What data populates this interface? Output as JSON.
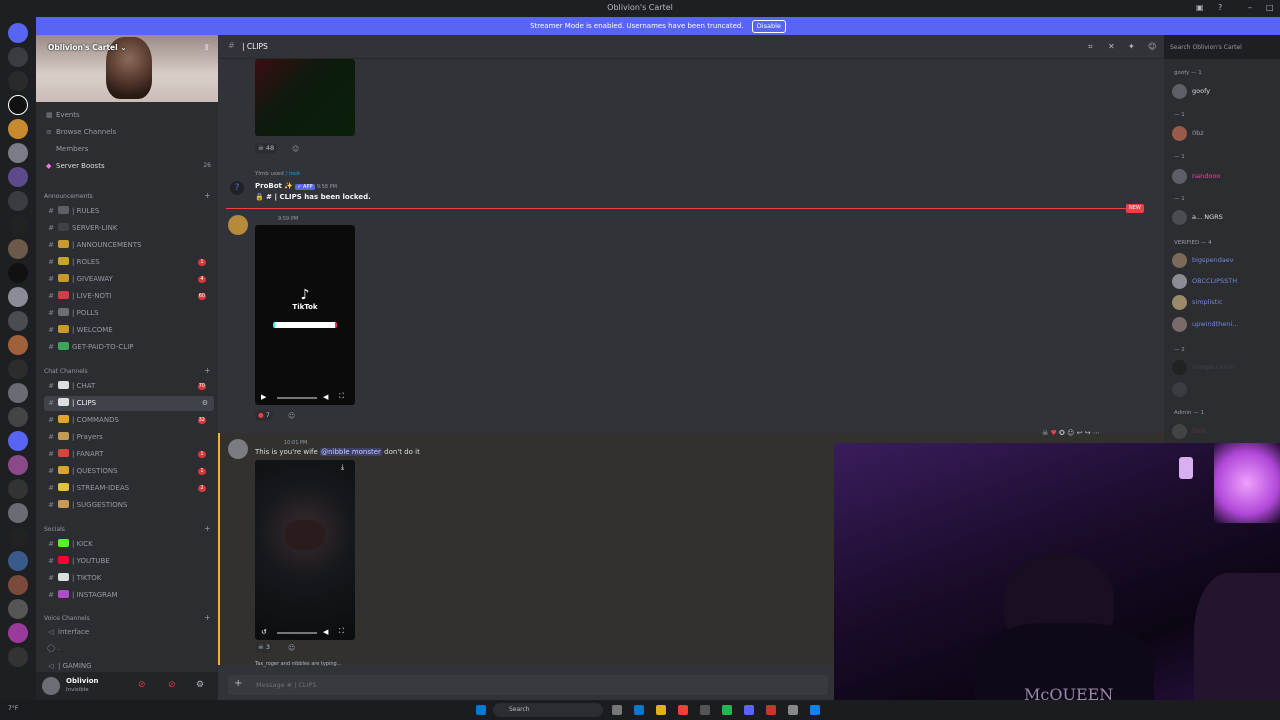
{
  "window": {
    "title": "Oblivion's Cartel"
  },
  "banner": {
    "text": "Streamer Mode is enabled. Usernames have been truncated.",
    "button": "Disable"
  },
  "server": {
    "name": "Oblivion's Cartel ⌄",
    "menu": [
      {
        "label": "Events"
      },
      {
        "label": "Browse Channels"
      },
      {
        "label": "Members"
      },
      {
        "label": "Server Boosts",
        "count": "26"
      }
    ]
  },
  "categories": {
    "announcements": "Announcements",
    "chat": "Chat Channels",
    "socials": "Socials",
    "voice": "Voice Channels"
  },
  "channels_announcements": [
    {
      "label": "| RULES",
      "color": "#5c5f66"
    },
    {
      "label": "SERVER-LINK",
      "color": "#3f4147"
    },
    {
      "label": "| ANNOUNCEMENTS",
      "color": "#c89a2e"
    },
    {
      "label": "| ROLES",
      "color": "#c8a22e",
      "badge": "1"
    },
    {
      "label": "| GIVEAWAY",
      "color": "#c89a2e",
      "badge": "4"
    },
    {
      "label": "| LIVE-NOTI",
      "color": "#d93a4a",
      "badge": "60"
    },
    {
      "label": "| POLLS",
      "color": "#6b6e75"
    },
    {
      "label": "| WELCOME",
      "color": "#c89a2e"
    },
    {
      "label": "GET-PAID-TO-CLIP",
      "color": "#3ba55c"
    }
  ],
  "channels_chat": [
    {
      "label": "| CHAT",
      "color": "#dcdde0",
      "badge": "70"
    },
    {
      "label": "| CLIPS",
      "color": "#dcdde0",
      "active": true
    },
    {
      "label": "| COMMANDS",
      "color": "#e0a32e",
      "badge": "32"
    },
    {
      "label": "| Prayers",
      "color": "#c49a55"
    },
    {
      "label": "| FANART",
      "color": "#d0493b",
      "badge": "1"
    },
    {
      "label": "| QUESTIONS",
      "color": "#d9a62a",
      "badge": "1"
    },
    {
      "label": "| STREAM-IDEAS",
      "color": "#e0c33a",
      "badge": "2"
    },
    {
      "label": "| SUGGESTIONS",
      "color": "#c49a55"
    }
  ],
  "channels_socials": [
    {
      "label": "| KICK",
      "color": "#53fc18"
    },
    {
      "label": "| YOUTUBE",
      "color": "#ff0033"
    },
    {
      "label": "| TIKTOK",
      "color": "#dcdde0"
    },
    {
      "label": "| INSTAGRAM",
      "color": "#b04cc8"
    }
  ],
  "channels_voice": [
    {
      "label": "interface"
    },
    {
      "label": "| GAMING"
    }
  ],
  "user": {
    "name": "Oblivion",
    "status": "Invisible"
  },
  "channel_header": {
    "name": "| CLIPS"
  },
  "search": {
    "placeholder": "Search Oblivion's Cartel"
  },
  "messages": {
    "reaction1": "48",
    "system": {
      "prefix": "Ylmb used",
      "command": "/ lock"
    },
    "probot": {
      "name": "ProBot ✨",
      "tag": "✓ APP",
      "time": "9:58 PM",
      "text": "| CLIPS has been locked."
    },
    "new_label": "NEW",
    "msg2": {
      "time": "9:59 PM",
      "video_label": "TikTok",
      "reaction": "7"
    },
    "msg3": {
      "time": "10:01 PM",
      "text_before": "This is you're wife",
      "mention": "@nibble monster",
      "text_after": "don't do it",
      "reaction": "3"
    },
    "typing": "Tax_roger and nibbles are typing..."
  },
  "composer": {
    "placeholder": "Message # | CLIPS"
  },
  "member_groups": [
    {
      "label": "goofy — 1"
    },
    {
      "label": "— 1"
    },
    {
      "label": "— 1"
    },
    {
      "label": "— 1"
    },
    {
      "label": "VERIFIED — 4"
    },
    {
      "label": "— 2"
    },
    {
      "label": "Admin — 1"
    }
  ],
  "members": [
    {
      "name": "goofy",
      "color": "#dbdee1"
    },
    {
      "name": "0bz",
      "color": "#949ba4"
    },
    {
      "name": "nandooo",
      "color": "#eb459e"
    },
    {
      "name": "a... NGRS",
      "color": "#dbdee1"
    },
    {
      "name": "bigspendaev",
      "color": "#7289da"
    },
    {
      "name": "OBCCLIPSSTH",
      "color": "#7289da"
    },
    {
      "name": "simplistic",
      "color": "#7289da"
    },
    {
      "name": "upwindtheni...",
      "color": "#7289da"
    },
    {
      "name": "sempa carter",
      "color": "#3f4147"
    },
    {
      "name": "Sinli",
      "color": "#5c3a3a"
    }
  ],
  "webcam_text": "McQUEEN",
  "taskbar": {
    "search": "Search",
    "time": "7°F"
  }
}
